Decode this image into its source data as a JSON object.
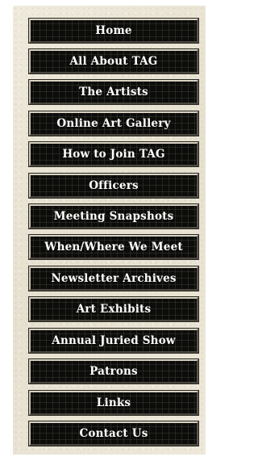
{
  "nav": {
    "items": [
      {
        "label": "Home"
      },
      {
        "label": "All About TAG"
      },
      {
        "label": "The Artists"
      },
      {
        "label": "Online Art Gallery"
      },
      {
        "label": "How to Join TAG"
      },
      {
        "label": "Officers"
      },
      {
        "label": "Meeting Snapshots"
      },
      {
        "label": "When/Where We Meet"
      },
      {
        "label": "Newsletter Archives"
      },
      {
        "label": "Art Exhibits"
      },
      {
        "label": "Annual Juried Show"
      },
      {
        "label": "Patrons"
      },
      {
        "label": "Links"
      },
      {
        "label": "Contact Us"
      }
    ]
  },
  "colors": {
    "panel_background": "#ece7d8",
    "button_background": "#0c0c0a",
    "button_text": "#ffffff"
  }
}
